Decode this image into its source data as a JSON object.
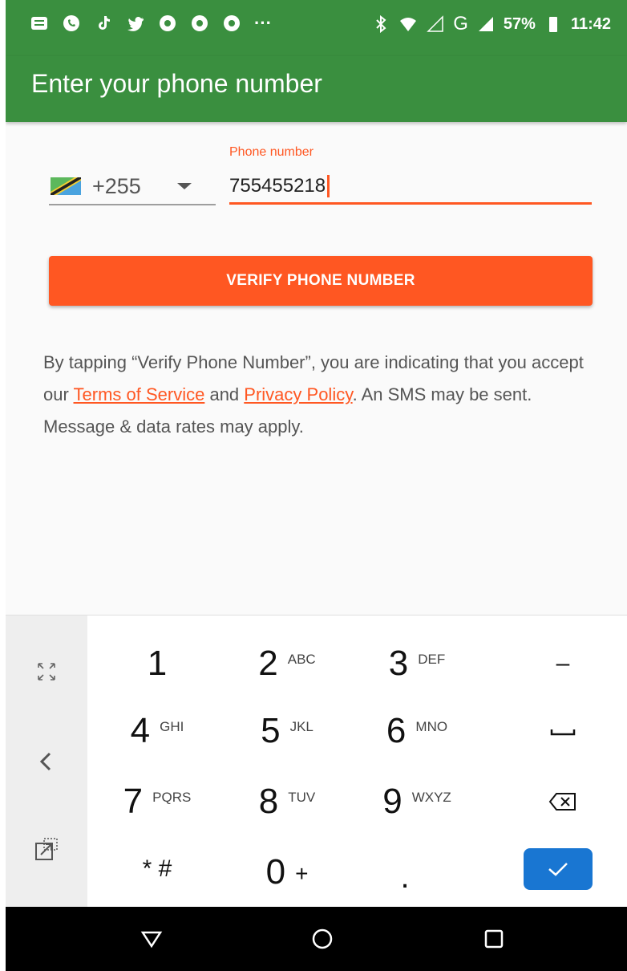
{
  "status_bar": {
    "battery": "57%",
    "time": "11:42",
    "network": "G",
    "more": "···"
  },
  "app_bar": {
    "title": "Enter your phone number"
  },
  "form": {
    "country_code": "+255",
    "phone_label": "Phone number",
    "phone_value": "755455218",
    "verify_label": "VERIFY PHONE NUMBER"
  },
  "terms": {
    "prefix": "By tapping “Verify Phone Number”, you are indicating that you accept our ",
    "tos_label": "Terms of Service",
    "and": " and ",
    "privacy_label": "Privacy Policy",
    "suffix": ". An SMS may be sent. Message & data rates may apply."
  },
  "keyboard": {
    "keys": [
      {
        "digit": "1",
        "letters": ""
      },
      {
        "digit": "2",
        "letters": "ABC"
      },
      {
        "digit": "3",
        "letters": "DEF"
      },
      {
        "digit": "4",
        "letters": "GHI"
      },
      {
        "digit": "5",
        "letters": "JKL"
      },
      {
        "digit": "6",
        "letters": "MNO"
      },
      {
        "digit": "7",
        "letters": "PQRS"
      },
      {
        "digit": "8",
        "letters": "TUV"
      },
      {
        "digit": "9",
        "letters": "WXYZ"
      },
      {
        "digit": "0",
        "letters": "+"
      }
    ],
    "minus": "–",
    "star_hash": "* #",
    "period": "."
  },
  "colors": {
    "app_bar": "#3a8f3f",
    "accent": "#ff5722",
    "enter": "#1976d2"
  }
}
